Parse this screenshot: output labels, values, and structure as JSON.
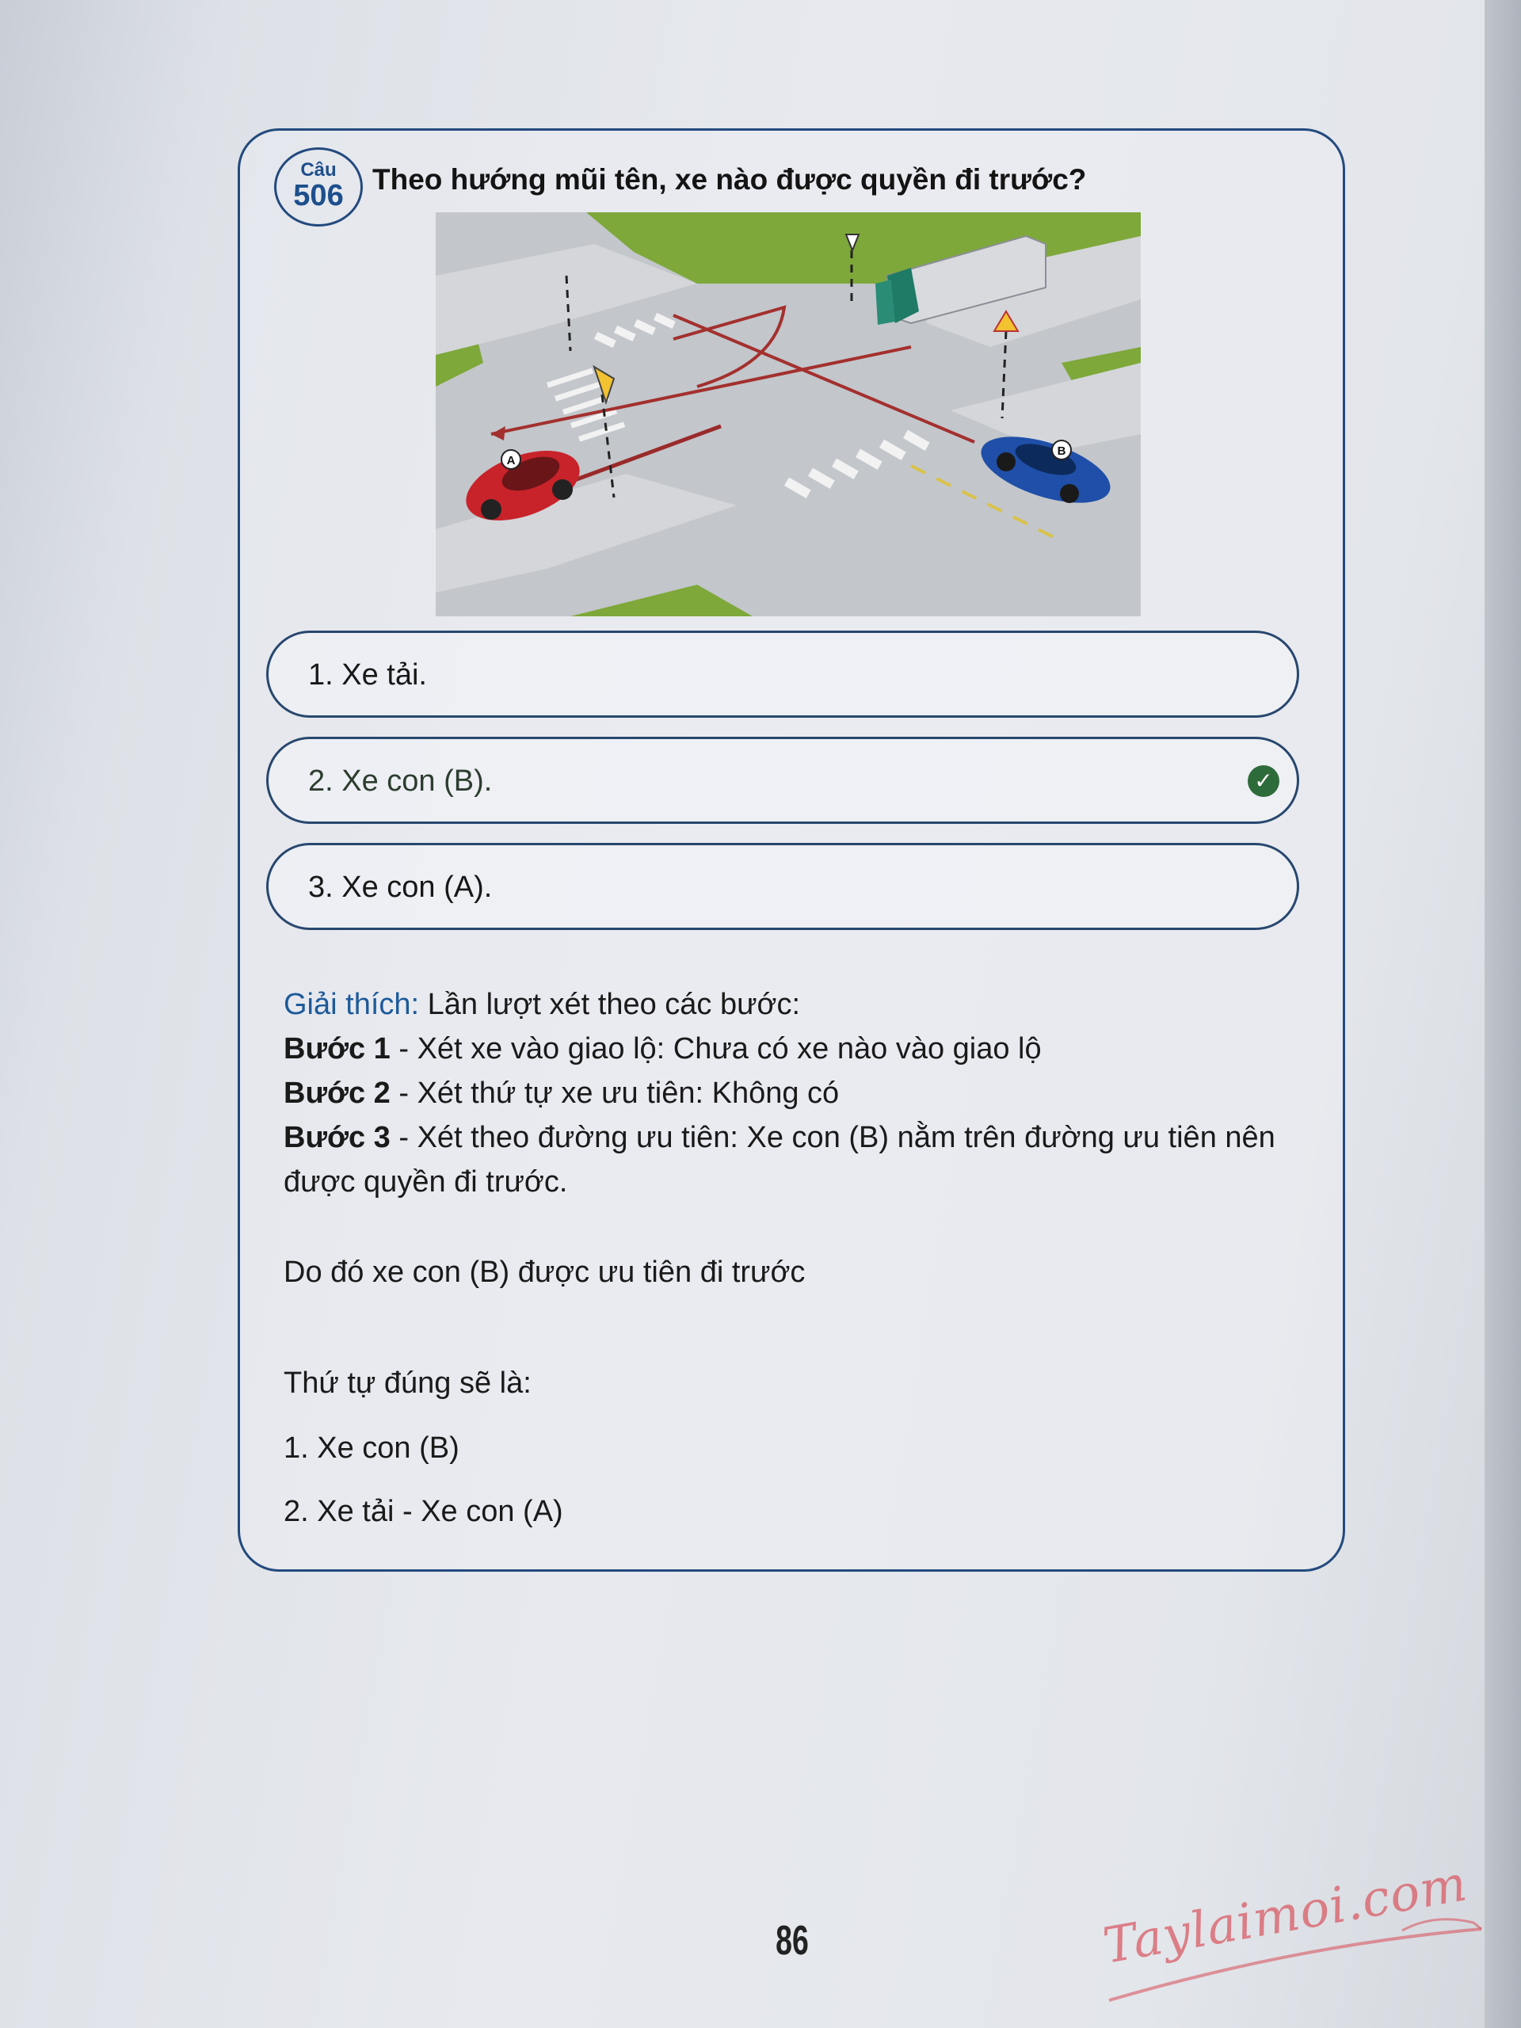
{
  "question": {
    "badge_label": "Câu",
    "badge_number": "506",
    "text": "Theo hướng mũi tên, xe nào được quyền đi trước?"
  },
  "illustration": {
    "car_a_label": "A",
    "car_b_label": "B",
    "colors": {
      "car_a": "#c8232a",
      "car_b": "#1f4fa8",
      "truck_cab": "#1f7a66",
      "grass": "#7ea83a",
      "road": "#b9bcc1"
    }
  },
  "options": [
    {
      "label": "1. Xe tải.",
      "correct": false
    },
    {
      "label": "2. Xe con (B).",
      "correct": true
    },
    {
      "label": "3. Xe con (A).",
      "correct": false
    }
  ],
  "correct_icon": "check-circle-icon",
  "explanation": {
    "label": "Giải thích:",
    "intro": " Lần lượt xét theo các bước:",
    "steps": [
      {
        "title": "Bước 1",
        "text": " - Xét xe vào giao lộ: Chưa có xe nào vào giao lộ"
      },
      {
        "title": "Bước 2",
        "text": " - Xét thứ tự xe ưu tiên: Không có"
      },
      {
        "title": "Bước 3",
        "text": " - Xét theo đường ưu tiên: Xe con (B) nằm trên đường ưu tiên nên được quyền đi trước."
      }
    ],
    "conclusion": "Do đó xe con (B) được ưu tiên đi trước",
    "order_title": "Thứ tự đúng sẽ là:",
    "order": [
      "1. Xe con (B)",
      "2. Xe tải - Xe con (A)"
    ]
  },
  "page_number": "86",
  "watermark": "Taylaimoi.com",
  "accent_color": "#234a7e"
}
